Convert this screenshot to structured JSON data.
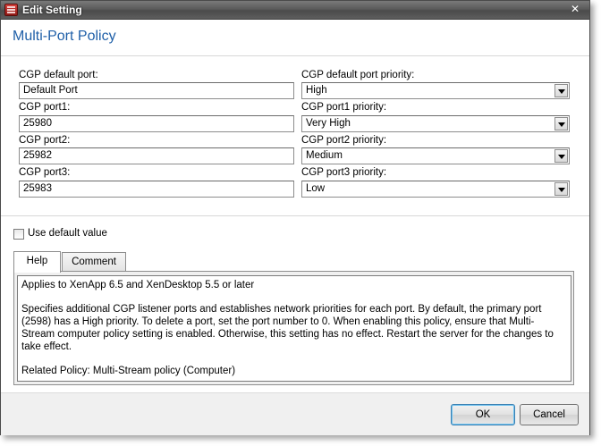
{
  "window": {
    "title": "Edit Setting",
    "close_label": "✕"
  },
  "heading": "Multi-Port Policy",
  "ports": [
    {
      "label": "CGP default port:",
      "value": "Default Port"
    },
    {
      "label": "CGP port1:",
      "value": "25980"
    },
    {
      "label": "CGP port2:",
      "value": "25982"
    },
    {
      "label": "CGP port3:",
      "value": "25983"
    }
  ],
  "priorities": [
    {
      "label": "CGP default port priority:",
      "value": "High"
    },
    {
      "label": "CGP port1 priority:",
      "value": "Very High"
    },
    {
      "label": "CGP port2 priority:",
      "value": "Medium"
    },
    {
      "label": "CGP port3 priority:",
      "value": "Low"
    }
  ],
  "use_default": {
    "label": "Use default value",
    "checked": false
  },
  "tabs": [
    {
      "label": "Help",
      "active": true
    },
    {
      "label": "Comment",
      "active": false
    }
  ],
  "help": {
    "line1": "Applies to XenApp 6.5 and XenDesktop 5.5 or later",
    "line2": "Specifies additional CGP listener ports and establishes network priorities for each port. By default, the primary port (2598) has a High priority. To delete a port, set the port number to 0. When enabling this policy, ensure that Multi-Stream computer policy setting is enabled. Otherwise, this setting has no effect. Restart the server for the changes to take effect.",
    "line3": "Related Policy: Multi-Stream policy (Computer)"
  },
  "buttons": {
    "ok": "OK",
    "cancel": "Cancel"
  }
}
